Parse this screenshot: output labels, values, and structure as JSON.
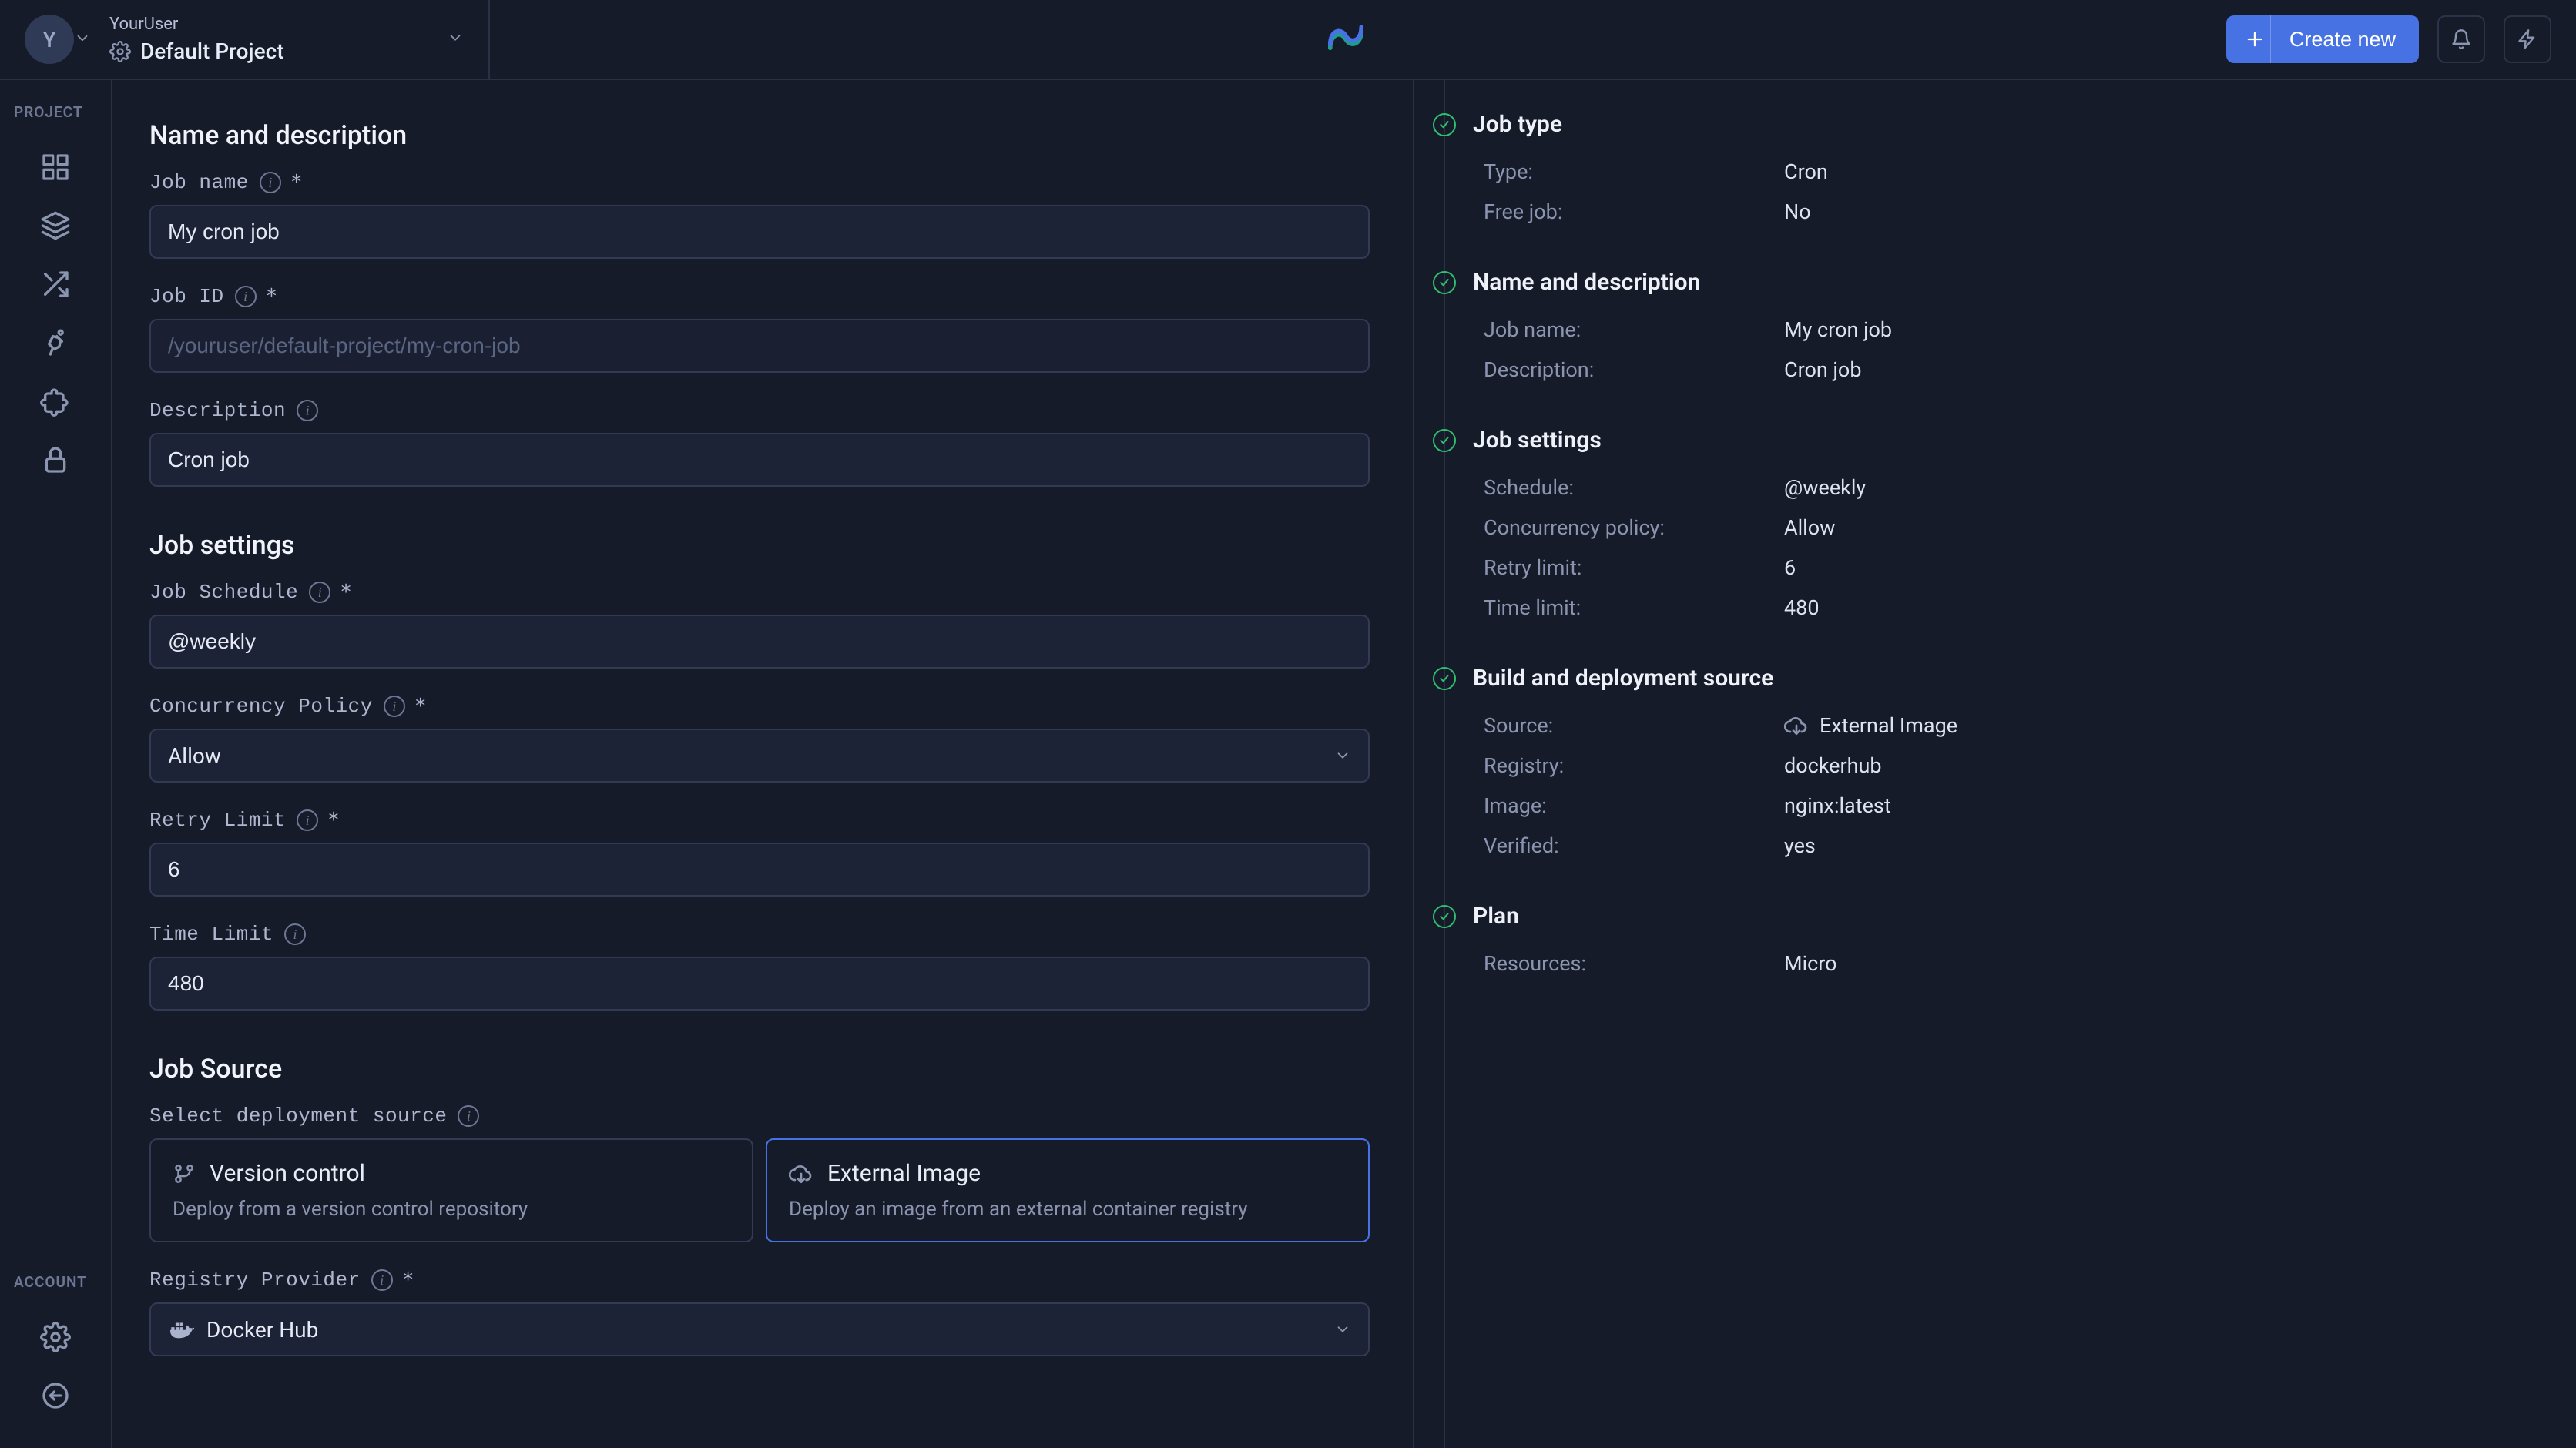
{
  "header": {
    "user_initial": "Y",
    "username": "YourUser",
    "project": "Default Project",
    "create_label": "Create new"
  },
  "rail": {
    "section_project": "PROJECT",
    "section_account": "ACCOUNT"
  },
  "form": {
    "sec_name_desc": "Name and description",
    "job_name_label": "Job name",
    "job_name_value": "My cron job",
    "job_id_label": "Job ID",
    "job_id_placeholder": "/youruser/default-project/my-cron-job",
    "description_label": "Description",
    "description_value": "Cron job",
    "sec_job_settings": "Job settings",
    "job_schedule_label": "Job Schedule",
    "job_schedule_value": "@weekly",
    "concurrency_label": "Concurrency Policy",
    "concurrency_value": "Allow",
    "retry_label": "Retry Limit",
    "retry_value": "6",
    "time_label": "Time Limit",
    "time_value": "480",
    "sec_job_source": "Job Source",
    "select_source_label": "Select deployment source",
    "vcs_title": "Version control",
    "vcs_desc": "Deploy from a version control repository",
    "ext_title": "External Image",
    "ext_desc": "Deploy an image from an external container registry",
    "registry_provider_label": "Registry Provider",
    "registry_provider_value": "Docker Hub"
  },
  "summary": {
    "job_type": {
      "title": "Job type",
      "type_k": "Type:",
      "type_v": "Cron",
      "free_k": "Free job:",
      "free_v": "No"
    },
    "name_desc": {
      "title": "Name and description",
      "name_k": "Job name:",
      "name_v": "My cron job",
      "desc_k": "Description:",
      "desc_v": "Cron job"
    },
    "settings": {
      "title": "Job settings",
      "sched_k": "Schedule:",
      "sched_v": "@weekly",
      "conc_k": "Concurrency policy:",
      "conc_v": "Allow",
      "retry_k": "Retry limit:",
      "retry_v": "6",
      "time_k": "Time limit:",
      "time_v": "480"
    },
    "build": {
      "title": "Build and deployment source",
      "src_k": "Source:",
      "src_v": "External Image",
      "reg_k": "Registry:",
      "reg_v": "dockerhub",
      "img_k": "Image:",
      "img_v": "nginx:latest",
      "ver_k": "Verified:",
      "ver_v": "yes"
    },
    "plan": {
      "title": "Plan",
      "res_k": "Resources:",
      "res_v": "Micro"
    }
  }
}
